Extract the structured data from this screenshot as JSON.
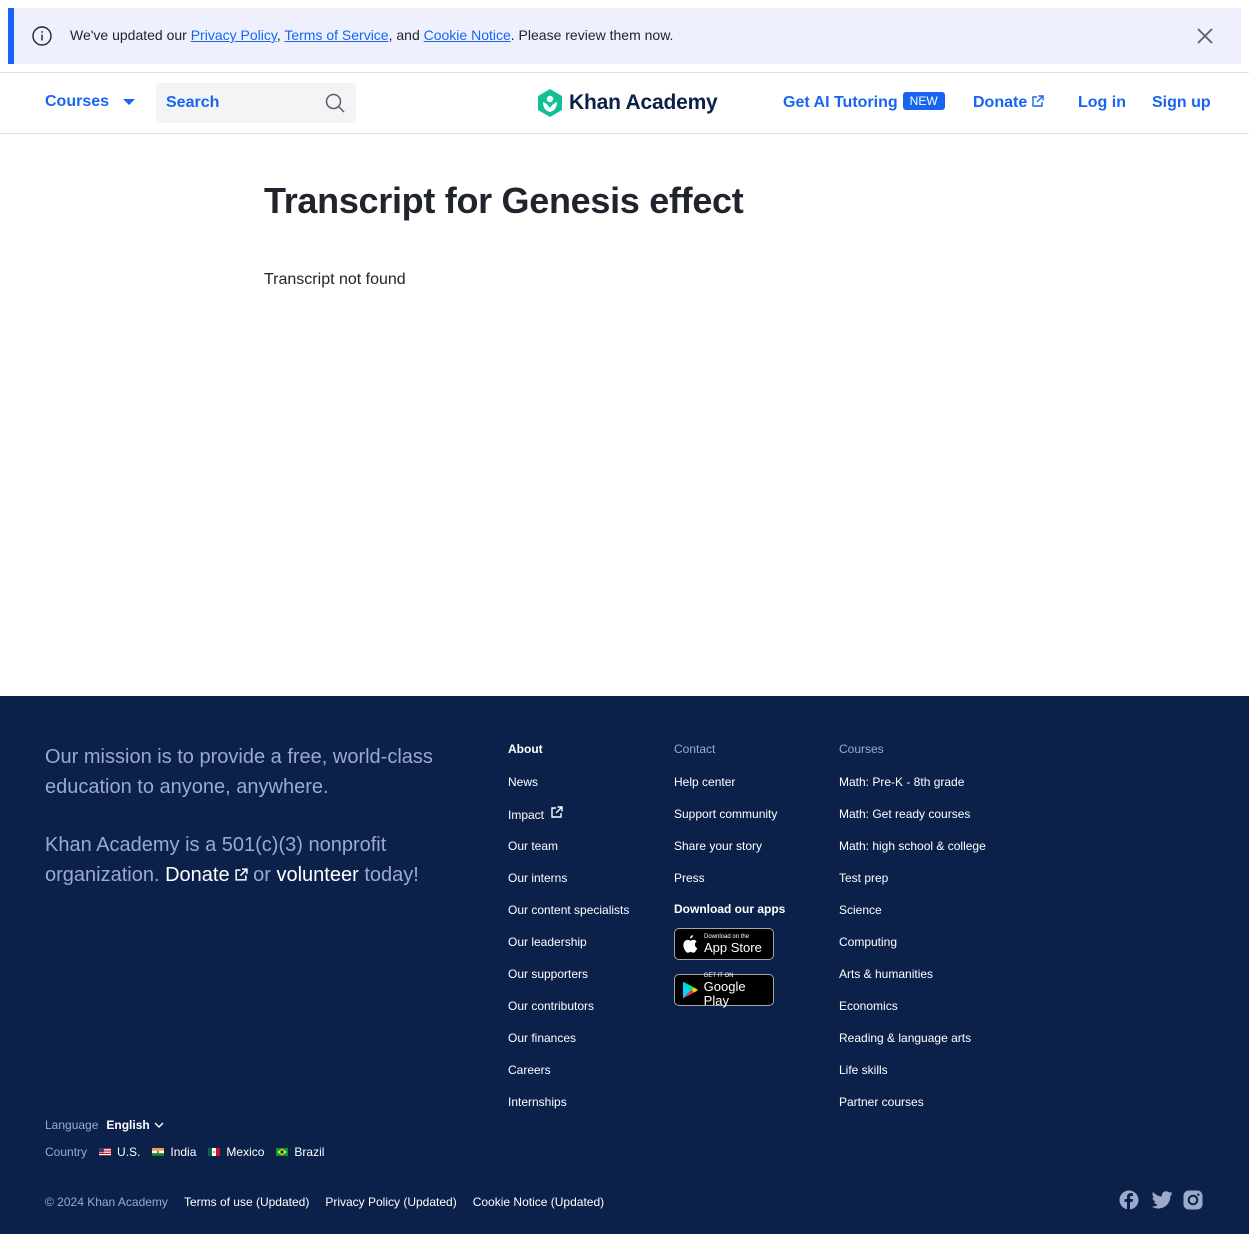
{
  "banner": {
    "prefix": "We've updated our ",
    "privacy_link": "Privacy Policy",
    "comma1": ", ",
    "terms_link": "Terms of Service",
    "and_text": ", and ",
    "cookie_link": "Cookie Notice",
    "suffix": ". Please review them now.",
    "info_icon": "info-circle-icon",
    "close_icon": "close-icon"
  },
  "header": {
    "courses_label": "Courses",
    "search_label": "Search",
    "logo_text": "Khan Academy",
    "tutoring_label": "Get AI Tutoring",
    "new_badge": "NEW",
    "donate_label": "Donate",
    "login_label": "Log in",
    "signup_label": "Sign up",
    "brand_color": "#1865f2",
    "logo_color": "#14bf96"
  },
  "main": {
    "title": "Transcript for Genesis effect",
    "message": "Transcript not found"
  },
  "footer": {
    "mission": "Our mission is to provide a free, world-class education to anyone, anywhere.",
    "nonprofit_prefix": "Khan Academy is a 501(c)(3) nonprofit organization. ",
    "donate": "Donate",
    "or": " or ",
    "volunteer": "volunteer",
    "today": " today!",
    "about": {
      "heading": "About",
      "links": [
        "News",
        "Impact",
        "Our team",
        "Our interns",
        "Our content specialists",
        "Our leadership",
        "Our supporters",
        "Our contributors",
        "Our finances",
        "Careers",
        "Internships"
      ]
    },
    "contact": {
      "heading": "Contact",
      "links": [
        "Help center",
        "Support community",
        "Share your story",
        "Press"
      ],
      "apps_heading": "Download our apps",
      "app_store_small": "Download on the",
      "app_store_big": "App Store",
      "google_small": "GET IT ON",
      "google_big": "Google Play"
    },
    "courses": {
      "heading": "Courses",
      "links": [
        "Math: Pre-K - 8th grade",
        "Math: Get ready courses",
        "Math: high school & college",
        "Test prep",
        "Science",
        "Computing",
        "Arts & humanities",
        "Economics",
        "Reading & language arts",
        "Life skills",
        "Partner courses"
      ]
    },
    "language_label": "Language",
    "language_value": "English",
    "country_label": "Country",
    "countries": [
      "U.S.",
      "India",
      "Mexico",
      "Brazil"
    ],
    "copyright": "© 2024 Khan Academy",
    "terms": "Terms of use (Updated)",
    "privacy": "Privacy Policy (Updated)",
    "cookie": "Cookie Notice (Updated)",
    "social_icons": [
      "facebook-icon",
      "twitter-icon",
      "instagram-icon"
    ],
    "bg_color": "#0b2149"
  }
}
